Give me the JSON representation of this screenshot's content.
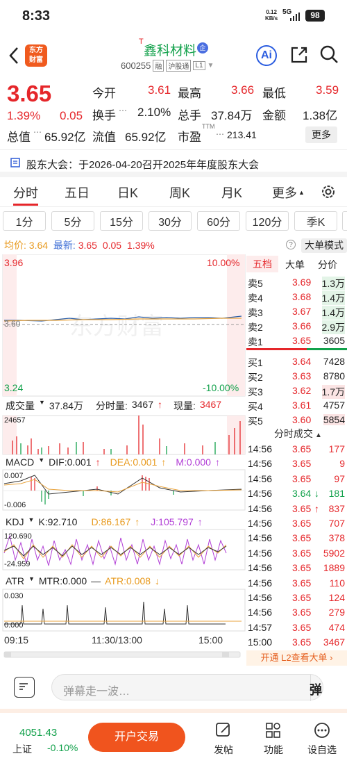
{
  "status": {
    "time": "8:33",
    "net_speed": "0.12",
    "net_unit": "KB/s",
    "network": "5G",
    "signal": "..il",
    "battery": "98"
  },
  "header": {
    "logo_top": "东方",
    "logo_bottom": "财富",
    "stock_name": "鑫科材料",
    "stock_prefix": "T",
    "stock_badge": "企",
    "stock_code": "600255",
    "tags": [
      "融",
      "沪股通",
      "L1"
    ]
  },
  "quote": {
    "price": "3.65",
    "change_pct": "1.39%",
    "change": "0.05",
    "open_label": "今开",
    "open": "3.61",
    "high_label": "最高",
    "high": "3.66",
    "low_label": "最低",
    "low": "3.59",
    "turnover_label": "换手",
    "turnover": "2.10%",
    "volume_label": "总手",
    "volume": "37.84万",
    "amount_label": "金额",
    "amount": "1.38亿",
    "total_value_label": "总值",
    "total_value": "65.92亿",
    "float_value_label": "流值",
    "float_value": "65.92亿",
    "pe_label": "市盈",
    "pe_sup": "TTM",
    "pe": "213.41",
    "more": "更多"
  },
  "notice": {
    "text": "股东大会：于2026-04-20召开2025年年度股东大会"
  },
  "tabs": [
    "分时",
    "五日",
    "日K",
    "周K",
    "月K",
    "更多"
  ],
  "subtabs": [
    "1分",
    "5分",
    "15分",
    "30分",
    "60分",
    "120分",
    "季K"
  ],
  "avg_line": {
    "avg_label": "均价:",
    "avg": "3.64",
    "latest_label": "最新:",
    "latest": "3.65",
    "chg": "0.05",
    "pct": "1.39%",
    "big_order": "大单模式"
  },
  "chart": {
    "price_high": "3.96",
    "price_low": "3.24",
    "pct_high": "10.00%",
    "pct_low": "-10.00%",
    "prev_close": "3.60",
    "watermark": "东方财富",
    "vol_label": "成交量",
    "vol_total": "37.84万",
    "vol_tick_label": "分时量:",
    "vol_tick": "3467",
    "vol_now_label": "现量:",
    "vol_now": "3467",
    "vol_max": "24657",
    "macd_label": "MACD",
    "dif": "DIF:0.001",
    "dea": "DEA:0.001",
    "m": "M:0.000",
    "macd_top": "0.007",
    "macd_bottom": "-0.006",
    "kdj_label": "KDJ",
    "k": "K:92.710",
    "d": "D:86.167",
    "j": "J:105.797",
    "kdj_top": "120.690",
    "kdj_bottom": "-24.959",
    "atr_label": "ATR",
    "mtr": "MTR:0.000",
    "atr": "ATR:0.008",
    "atr_top": "0.030",
    "atr_bottom": "0.000",
    "time_start": "09:15",
    "time_mid": "11:30/13:00",
    "time_end": "15:00"
  },
  "order_book": {
    "tabs": [
      "五档",
      "大单",
      "分价"
    ],
    "asks": [
      {
        "label": "卖5",
        "price": "3.69",
        "vol": "1.3万"
      },
      {
        "label": "卖4",
        "price": "3.68",
        "vol": "1.4万"
      },
      {
        "label": "卖3",
        "price": "3.67",
        "vol": "1.4万"
      },
      {
        "label": "卖2",
        "price": "3.66",
        "vol": "2.9万"
      },
      {
        "label": "卖1",
        "price": "3.65",
        "vol": "3605"
      }
    ],
    "bids": [
      {
        "label": "买1",
        "price": "3.64",
        "vol": "7428"
      },
      {
        "label": "买2",
        "price": "3.63",
        "vol": "8780"
      },
      {
        "label": "买3",
        "price": "3.62",
        "vol": "1.7万"
      },
      {
        "label": "买4",
        "price": "3.61",
        "vol": "4757"
      },
      {
        "label": "买5",
        "price": "3.60",
        "vol": "5854"
      }
    ]
  },
  "trades": {
    "title": "分时成交",
    "rows": [
      {
        "time": "14:56",
        "price": "3.65",
        "vol": "177",
        "dir": "red"
      },
      {
        "time": "14:56",
        "price": "3.65",
        "vol": "9",
        "dir": "red"
      },
      {
        "time": "14:56",
        "price": "3.65",
        "vol": "97",
        "dir": "red"
      },
      {
        "time": "14:56",
        "price": "3.64",
        "vol": "181",
        "dir": "green",
        "arrow": "↓"
      },
      {
        "time": "14:56",
        "price": "3.65",
        "vol": "837",
        "dir": "red",
        "arrow": "↑"
      },
      {
        "time": "14:56",
        "price": "3.65",
        "vol": "707",
        "dir": "red"
      },
      {
        "time": "14:56",
        "price": "3.65",
        "vol": "378",
        "dir": "red"
      },
      {
        "time": "14:56",
        "price": "3.65",
        "vol": "5902",
        "dir": "red"
      },
      {
        "time": "14:56",
        "price": "3.65",
        "vol": "1889",
        "dir": "red"
      },
      {
        "time": "14:56",
        "price": "3.65",
        "vol": "110",
        "dir": "red"
      },
      {
        "time": "14:56",
        "price": "3.65",
        "vol": "124",
        "dir": "red"
      },
      {
        "time": "14:56",
        "price": "3.65",
        "vol": "279",
        "dir": "red"
      },
      {
        "time": "14:57",
        "price": "3.65",
        "vol": "474",
        "dir": "red"
      },
      {
        "time": "15:00",
        "price": "3.65",
        "vol": "3467",
        "dir": "red"
      }
    ],
    "l2_link": "开通 L2查看大单"
  },
  "comment": {
    "placeholder": "弹幕走一波…",
    "danmu": "弹"
  },
  "footer": {
    "index_value": "4051.43",
    "index_name": "上证",
    "index_pct": "-0.10%",
    "trade": "开户交易",
    "post": "发帖",
    "function": "功能",
    "self_select": "设自选"
  }
}
